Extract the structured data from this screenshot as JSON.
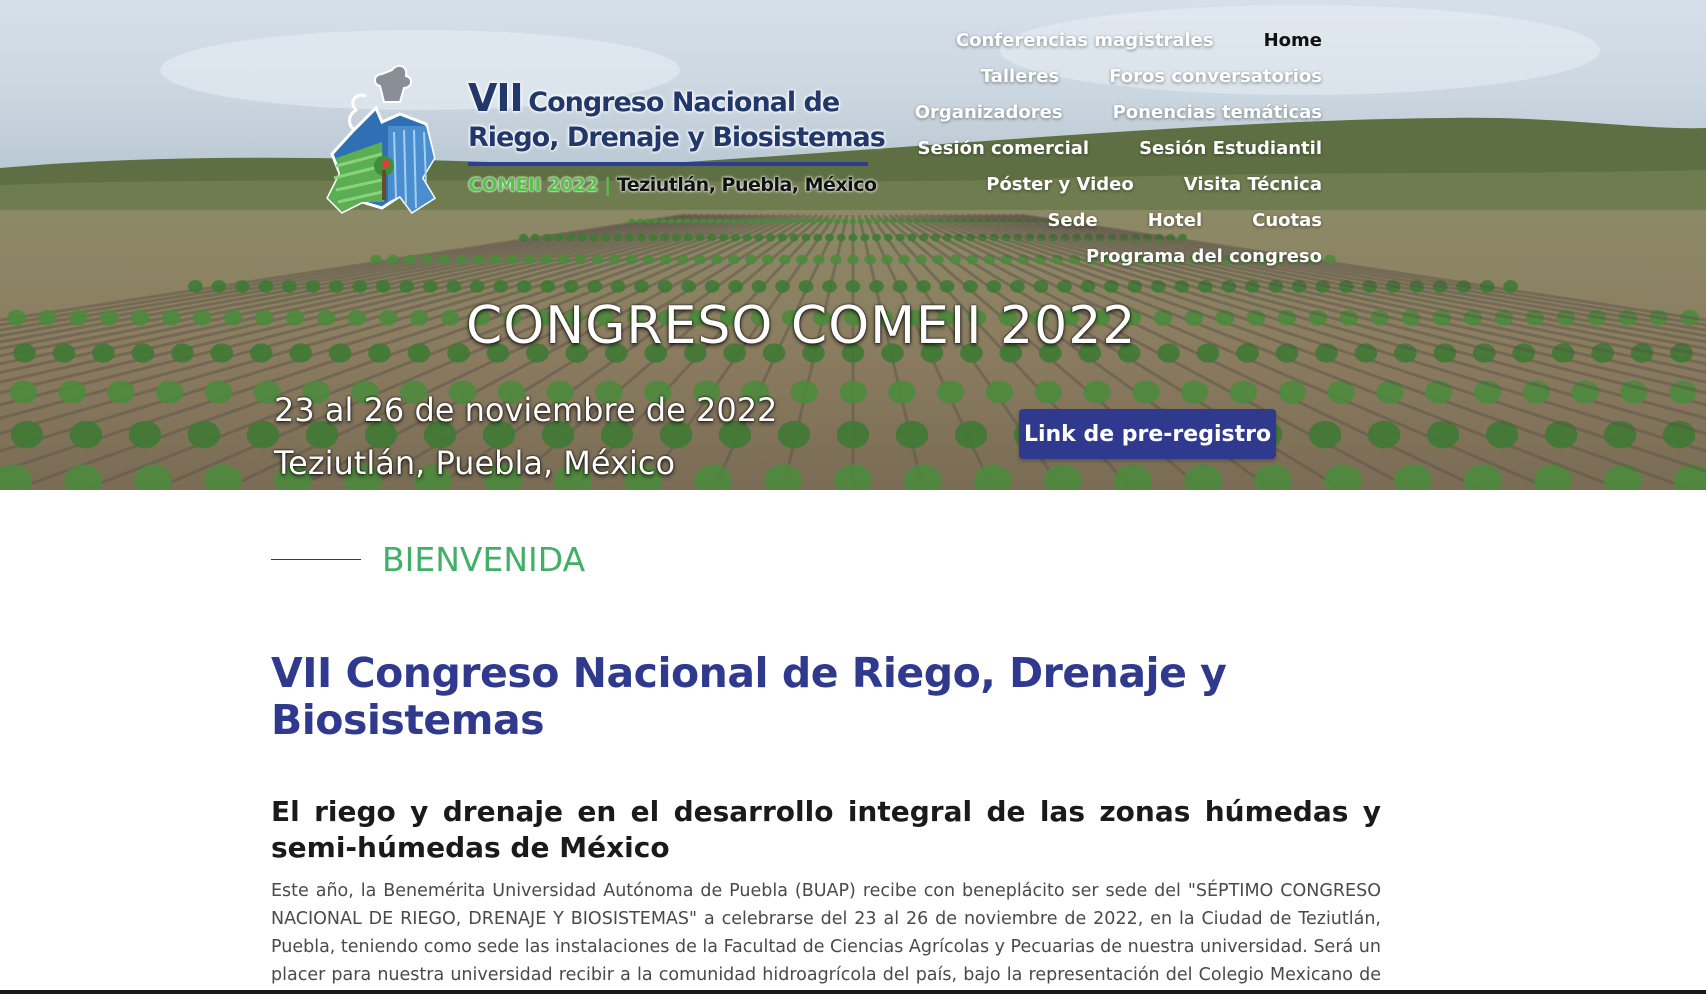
{
  "nav": {
    "rows": [
      [
        {
          "label": "Conferencias magistrales",
          "active": false
        },
        {
          "label": "Home",
          "active": true
        }
      ],
      [
        {
          "label": "Talleres",
          "active": false
        },
        {
          "label": "Foros conversatorios",
          "active": false
        }
      ],
      [
        {
          "label": "Organizadores",
          "active": false
        },
        {
          "label": "Ponencias temáticas",
          "active": false
        }
      ],
      [
        {
          "label": "Sesión comercial",
          "active": false
        },
        {
          "label": "Sesión Estudiantil",
          "active": false
        }
      ],
      [
        {
          "label": "Póster y Video",
          "active": false
        },
        {
          "label": "Visita Técnica",
          "active": false
        }
      ],
      [
        {
          "label": "Sede",
          "active": false
        },
        {
          "label": "Hotel",
          "active": false
        },
        {
          "label": "Cuotas",
          "active": false
        }
      ],
      [
        {
          "label": "Programa del congreso",
          "active": false
        }
      ]
    ]
  },
  "logo": {
    "line1_vii": "VII",
    "line1_rest": "Congreso Nacional de",
    "line2": "Riego, Drenaje y Biosistemas",
    "sub_comeii": "COMEII 2022",
    "sub_sep": "|",
    "sub_place": "Teziutlán, Puebla, México"
  },
  "hero": {
    "title": "CONGRESO COMEII 2022",
    "date": "23 al 26 de noviembre de 2022",
    "place": "Teziutlán, Puebla, México",
    "prereg_label": "Link de pre-registro"
  },
  "content": {
    "welcome": "BIENVENIDA",
    "title": "VII Congreso Nacional de Riego, Drenaje y Biosistemas",
    "subtitle": "El riego y drenaje en el desarrollo integral de las zonas húmedas y semi-húmedas de México",
    "body": "Este año, la Benemérita Universidad Autónoma de Puebla (BUAP) recibe con beneplácito ser sede del \"SÉPTIMO CONGRESO NACIONAL DE RIEGO, DRENAJE Y BIOSISTEMAS\" a celebrarse del 23 al 26 de noviembre de 2022, en la Ciudad de Teziutlán, Puebla, teniendo como sede las instalaciones de la Facultad de Ciencias Agrícolas y Pecuarias de nuestra universidad. Será un placer para nuestra universidad recibir a la comunidad hidroagrícola del país, bajo la representación del Colegio Mexicano de Ingenieros en"
  },
  "colors": {
    "brand_blue": "#2f3a8f",
    "welcome_green": "#41b067",
    "logo_green": "#59c24b"
  }
}
